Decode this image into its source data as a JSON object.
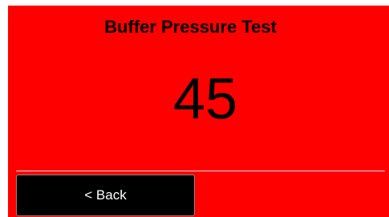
{
  "screen": {
    "title": "Buffer Pressure Test",
    "value": "45",
    "background_color": "#ff0000"
  },
  "footer": {
    "back_label": "< Back"
  }
}
